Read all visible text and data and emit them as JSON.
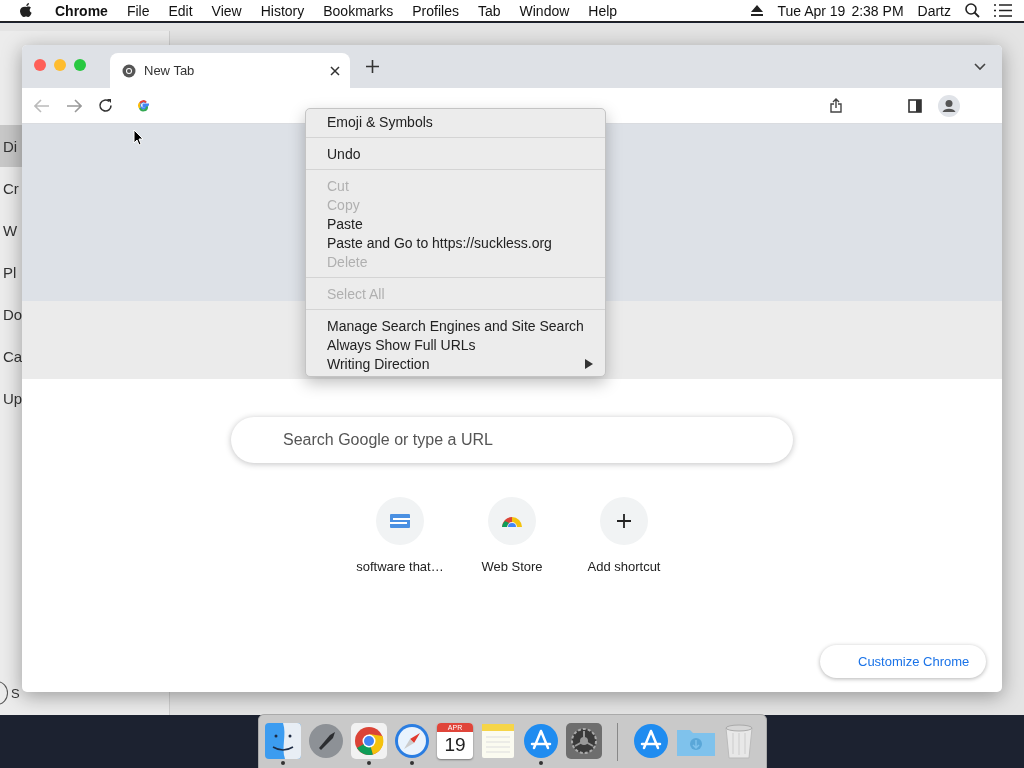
{
  "menu_bar": {
    "app": "Chrome",
    "menus": [
      "File",
      "Edit",
      "View",
      "History",
      "Bookmarks",
      "Profiles",
      "Tab",
      "Window",
      "Help"
    ],
    "date": "Tue Apr 19",
    "time": "2:38 PM",
    "user": "Dartz"
  },
  "background_window": {
    "items": [
      {
        "label": "Di",
        "selected": true
      },
      {
        "label": "Cr",
        "selected": false
      },
      {
        "label": "W",
        "selected": false
      },
      {
        "label": "Pl",
        "selected": false
      },
      {
        "label": "Do",
        "selected": false
      },
      {
        "label": "Ca",
        "selected": false
      },
      {
        "label": "Up",
        "selected": false
      }
    ],
    "footer": "S"
  },
  "browser": {
    "tabs": [
      {
        "title": "New Tab",
        "selected": true
      }
    ],
    "search": {
      "placeholder": "Search Google or type a URL"
    },
    "shortcuts": [
      {
        "kind": "doc",
        "label": "software that…"
      },
      {
        "kind": "store",
        "label": "Web Store"
      },
      {
        "kind": "add",
        "label": "Add shortcut"
      }
    ],
    "customize_button": "Customize Chrome"
  },
  "context_menu": {
    "sections": [
      [
        {
          "label": "Emoji & Symbols",
          "disabled": false,
          "submenu": false
        }
      ],
      [
        {
          "label": "Undo",
          "disabled": false,
          "submenu": false
        }
      ],
      [
        {
          "label": "Cut",
          "disabled": true,
          "submenu": false
        },
        {
          "label": "Copy",
          "disabled": true,
          "submenu": false
        },
        {
          "label": "Paste",
          "disabled": false,
          "submenu": false
        },
        {
          "label": "Paste and Go to https://suckless.org",
          "disabled": false,
          "submenu": false
        },
        {
          "label": "Delete",
          "disabled": true,
          "submenu": false
        }
      ],
      [
        {
          "label": "Select All",
          "disabled": true,
          "submenu": false
        }
      ],
      [
        {
          "label": "Manage Search Engines and Site Search",
          "disabled": false,
          "submenu": false
        },
        {
          "label": "Always Show Full URLs",
          "disabled": false,
          "submenu": false
        },
        {
          "label": "Writing Direction",
          "disabled": false,
          "submenu": true
        }
      ]
    ]
  },
  "dock": {
    "apps": [
      {
        "kind": "finder",
        "running": true
      },
      {
        "kind": "launchpad",
        "running": false
      },
      {
        "kind": "chrome",
        "running": true
      },
      {
        "kind": "safari",
        "running": true
      },
      {
        "kind": "calendar",
        "running": false,
        "month": "APR",
        "day": "19"
      },
      {
        "kind": "notes",
        "running": false
      },
      {
        "kind": "appstore",
        "running": true
      },
      {
        "kind": "settings",
        "running": false
      }
    ],
    "others": [
      {
        "kind": "appstore",
        "running": false
      },
      {
        "kind": "folder",
        "running": false
      },
      {
        "kind": "trash",
        "running": false
      }
    ]
  }
}
